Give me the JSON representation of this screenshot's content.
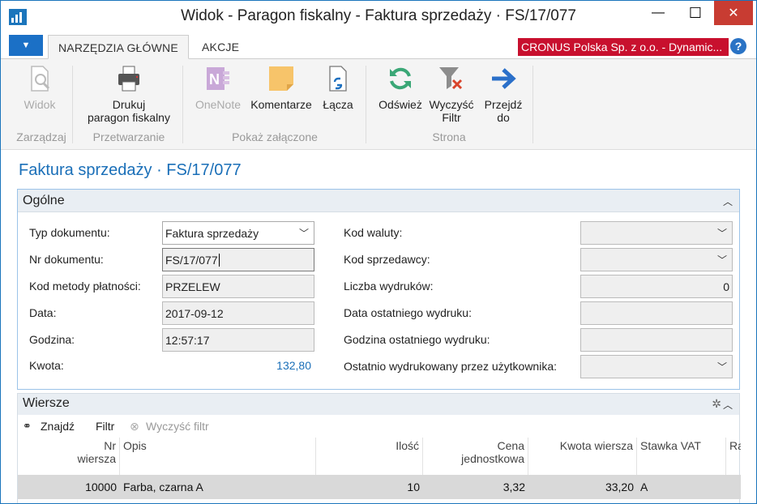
{
  "window": {
    "title": "Widok - Paragon fiskalny - Faktura sprzedaży · FS/17/077",
    "minimize_glyph": "—",
    "maximize_glyph": "☐",
    "close_glyph": "✕"
  },
  "tabs": {
    "file_glyph": "▼",
    "home": "NARZĘDZIA GŁÓWNE",
    "actions": "AKCJE",
    "company": "CRONUS Polska Sp. z o.o. - Dynamic...",
    "help": "?"
  },
  "ribbon": {
    "view_label": "Widok",
    "print_label_1": "Drukuj",
    "print_label_2": "paragon fiskalny",
    "onenote_label": "OneNote",
    "notes_label": "Komentarze",
    "links_label": "Łącza",
    "refresh_label": "Odśwież",
    "clear_filter_1": "Wyczyść",
    "clear_filter_2": "Filtr",
    "goto_1": "Przejdź",
    "goto_2": "do",
    "group_manage": "Zarządzaj",
    "group_process": "Przetwarzanie",
    "group_attached": "Pokaż załączone",
    "group_page": "Strona"
  },
  "page_title": "Faktura sprzedaży · FS/17/077",
  "general": {
    "title": "Ogólne",
    "doc_type_label": "Typ dokumentu:",
    "doc_type_value": "Faktura sprzedaży",
    "doc_no_label": "Nr dokumentu:",
    "doc_no_value": "FS/17/077",
    "payment_label": "Kod metody płatności:",
    "payment_value": "PRZELEW",
    "date_label": "Data:",
    "date_value": "2017-09-12",
    "time_label": "Godzina:",
    "time_value": "12:57:17",
    "amount_label": "Kwota:",
    "amount_value": "132,80",
    "currency_label": "Kod waluty:",
    "currency_value": "",
    "salesperson_label": "Kod sprzedawcy:",
    "salesperson_value": "",
    "print_count_label": "Liczba wydruków:",
    "print_count_value": "0",
    "last_print_date_label": "Data ostatniego wydruku:",
    "last_print_date_value": "",
    "last_print_time_label": "Godzina ostatniego wydruku:",
    "last_print_time_value": "",
    "last_printed_by_label": "Ostatnio wydrukowany przez użytkownika:",
    "last_printed_by_value": ""
  },
  "lines": {
    "title": "Wiersze",
    "find": "Znajdź",
    "filter": "Filtr",
    "clear_filter": "Wyczyść filtr",
    "columns": {
      "line_no_1": "Nr",
      "line_no_2": "wiersza",
      "description": "Opis",
      "quantity": "Ilość",
      "unit_price_1": "Cena",
      "unit_price_2": "jednostkowa",
      "line_amount": "Kwota wiersza",
      "vat_rate": "Stawka VAT",
      "more": "Ra"
    },
    "rows": [
      {
        "line_no": "10000",
        "description": "Farba, czarna A",
        "quantity": "10",
        "unit_price": "3,32",
        "line_amount": "33,20",
        "vat": "A"
      }
    ]
  },
  "colors": {
    "accent": "#1a6fb8",
    "company_banner": "#c8102e",
    "close_button": "#c83c32"
  }
}
